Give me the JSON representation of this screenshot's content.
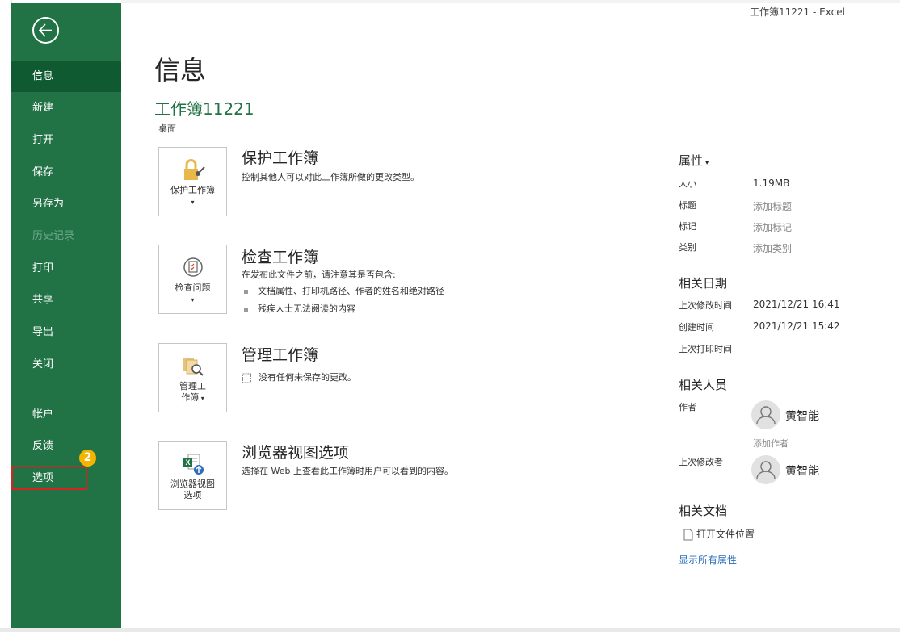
{
  "window": {
    "title": "工作簿11221  -  Excel"
  },
  "nav": {
    "items": [
      {
        "label": "信息",
        "state": "active"
      },
      {
        "label": "新建",
        "state": "normal"
      },
      {
        "label": "打开",
        "state": "normal"
      },
      {
        "label": "保存",
        "state": "normal"
      },
      {
        "label": "另存为",
        "state": "normal"
      },
      {
        "label": "历史记录",
        "state": "disabled"
      },
      {
        "label": "打印",
        "state": "normal"
      },
      {
        "label": "共享",
        "state": "normal"
      },
      {
        "label": "导出",
        "state": "normal"
      },
      {
        "label": "关闭",
        "state": "normal"
      },
      {
        "label": "帐户",
        "state": "normal"
      },
      {
        "label": "反馈",
        "state": "normal"
      },
      {
        "label": "选项",
        "state": "highlighted"
      }
    ],
    "badge": "2"
  },
  "main": {
    "title": "信息",
    "doc_name": "工作簿11221",
    "doc_location": "桌面",
    "sections": [
      {
        "button_label_1": "保护工作簿",
        "button_label_2": "",
        "title": "保护工作簿",
        "desc": "控制其他人可以对此工作簿所做的更改类型。"
      },
      {
        "button_label_1": "检查问题",
        "button_label_2": "",
        "title": "检查工作簿",
        "desc": "在发布此文件之前，请注意其是否包含:",
        "bullets": [
          "文档属性、打印机路径、作者的姓名和绝对路径",
          "残疾人士无法阅读的内容"
        ]
      },
      {
        "button_label_1": "管理工",
        "button_label_2": "作簿",
        "title": "管理工作簿",
        "desc": "没有任何未保存的更改。"
      },
      {
        "button_label_1": "浏览器视图",
        "button_label_2": "选项",
        "title": "浏览器视图选项",
        "desc": "选择在 Web 上查看此工作簿时用户可以看到的内容。"
      }
    ]
  },
  "properties": {
    "heading": "属性",
    "rows": [
      {
        "label": "大小",
        "value": "1.19MB"
      },
      {
        "label": "标题",
        "value": "添加标题"
      },
      {
        "label": "标记",
        "value": "添加标记"
      },
      {
        "label": "类别",
        "value": "添加类别"
      }
    ],
    "dates_heading": "相关日期",
    "dates": [
      {
        "label": "上次修改时间",
        "value": "2021/12/21 16:41"
      },
      {
        "label": "创建时间",
        "value": "2021/12/21 15:42"
      },
      {
        "label": "上次打印时间",
        "value": ""
      }
    ],
    "people_heading": "相关人员",
    "author_label": "作者",
    "author_name": "黄智能",
    "add_author": "添加作者",
    "modifier_label": "上次修改者",
    "modifier_name": "黄智能",
    "docs_heading": "相关文档",
    "open_location": "打开文件位置",
    "show_all": "显示所有属性"
  },
  "colors": {
    "sidebar": "#217346",
    "active": "#0f5a31",
    "accent": "#217346",
    "highlight_border": "#d42323",
    "badge": "#f5b400",
    "link": "#2a6ebb"
  }
}
